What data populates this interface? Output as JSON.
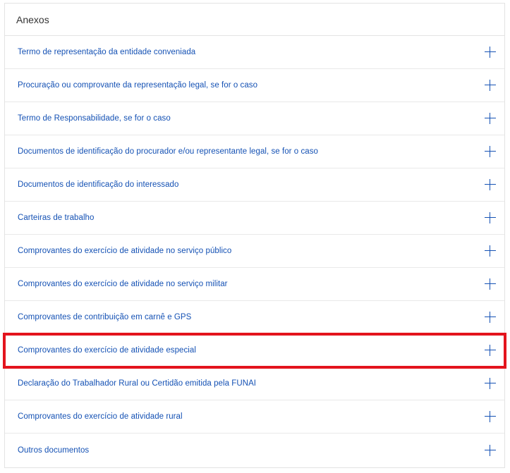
{
  "panel": {
    "title": "Anexos",
    "items": [
      {
        "label": "Termo de representação da entidade conveniada"
      },
      {
        "label": "Procuração ou comprovante da representação legal, se for o caso"
      },
      {
        "label": "Termo de Responsabilidade, se for o caso"
      },
      {
        "label": "Documentos de identificação do procurador e/ou representante legal, se for o caso"
      },
      {
        "label": "Documentos de identificação do interessado"
      },
      {
        "label": "Carteiras de trabalho"
      },
      {
        "label": "Comprovantes do exercício de atividade no serviço público"
      },
      {
        "label": "Comprovantes do exercício de atividade no serviço militar"
      },
      {
        "label": "Comprovantes de contribuição em carnê e GPS"
      },
      {
        "label": "Comprovantes do exercício de atividade especial"
      },
      {
        "label": "Declaração do Trabalhador Rural ou Certidão emitida pela FUNAI"
      },
      {
        "label": "Comprovantes do exercício de atividade rural"
      },
      {
        "label": "Outros documentos"
      }
    ]
  },
  "colors": {
    "link": "#1451b4",
    "highlight": "#e3141d",
    "border": "#e3e3e3"
  },
  "icons": {
    "expand": "plus-icon"
  }
}
